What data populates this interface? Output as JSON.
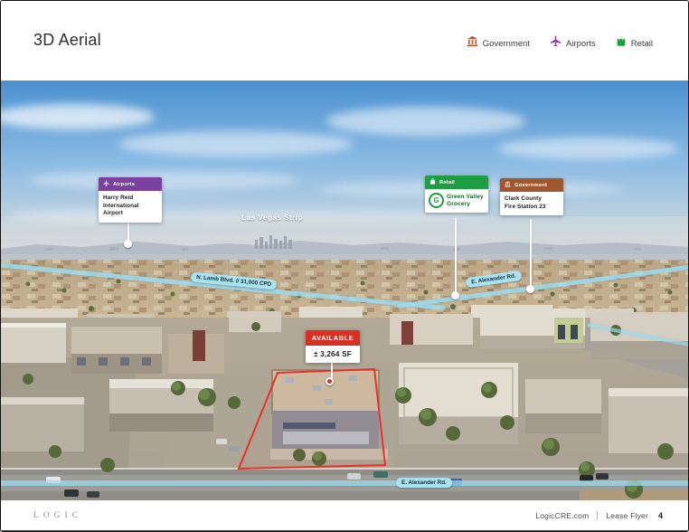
{
  "page": {
    "title": "3D Aerial"
  },
  "legend": {
    "items": [
      {
        "label": "Government",
        "icon": "government-bank-icon",
        "color": "#B0542F"
      },
      {
        "label": "Airports",
        "icon": "airplane-icon",
        "color": "#7B3FA0"
      },
      {
        "label": "Retail",
        "icon": "shopping-bag-icon",
        "color": "#1F9D44"
      }
    ]
  },
  "aerial": {
    "strip_label": "Las Vegas Strip",
    "road_labels": {
      "lamb": "N. Lamb Blvd. // 31,000 CPD",
      "alexander_far": "E. Alexander Rd.",
      "alexander_near": "E. Alexander Rd."
    },
    "callouts": {
      "airport": {
        "category": "Airports",
        "line1": "Harry Reid",
        "line2": "International Airport"
      },
      "retail": {
        "category": "Retail",
        "monogram": "G",
        "line1": "Green Valley",
        "line2": "Grocery"
      },
      "government": {
        "category": "Government",
        "line1": "Clark County",
        "line2": "Fire Station 23"
      },
      "available": {
        "status": "AVAILABLE",
        "area": "± 3,264 SF"
      }
    }
  },
  "footer": {
    "logo": "LOGIC",
    "website": "LogicCRE.com",
    "document": "Lease Flyer",
    "page_number": "4"
  },
  "colors": {
    "airports_purple": "#7B3FA0",
    "retail_green": "#1F9D44",
    "government_brown": "#A0572F",
    "available_red": "#D93025",
    "road_ribbon_blue": "#ABE2F1"
  }
}
